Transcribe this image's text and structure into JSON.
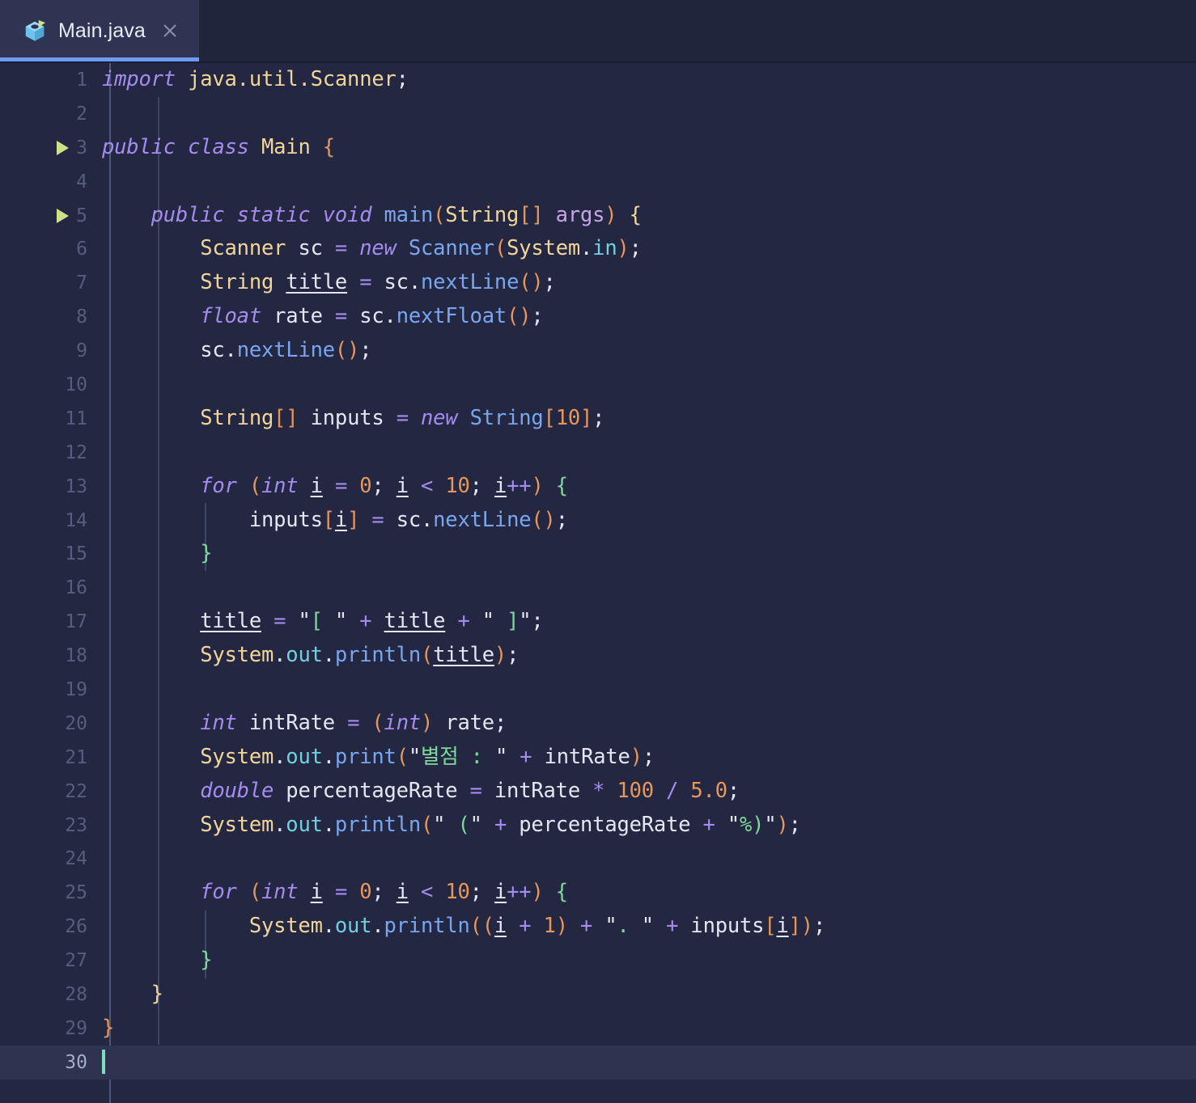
{
  "window": {
    "app": "java-code-editor",
    "background_color": "#232741"
  },
  "tabbar": {
    "background_color": "#21253c",
    "active_indicator_color": "#6c9bf5",
    "tabs": [
      {
        "label": "Main.java",
        "icon": "java-class-icon",
        "close_icon": "close-icon",
        "active": true
      }
    ]
  },
  "editor": {
    "language": "java",
    "total_lines": 30,
    "current_line": 30,
    "caret_column": 1,
    "caret_color": "#7fdcc0",
    "current_line_highlight_color": "#2e3450",
    "gutter": {
      "line_numbers": [
        1,
        2,
        3,
        4,
        5,
        6,
        7,
        8,
        9,
        10,
        11,
        12,
        13,
        14,
        15,
        16,
        17,
        18,
        19,
        20,
        21,
        22,
        23,
        24,
        25,
        26,
        27,
        28,
        29,
        30
      ],
      "run_markers": [
        3,
        5
      ],
      "run_marker_icon": "run-play-icon",
      "run_marker_color": "#cfe08a",
      "number_color": "#555e7e",
      "current_number_color": "#a3acc9"
    },
    "theme_colors": {
      "keyword": "#a48cf0",
      "class_type": "#f2d59b",
      "method": "#7aa6f0",
      "field": "#6fd0e0",
      "identifier": "#e4e7f2",
      "number": "#e8965a",
      "operator": "#a48cf0",
      "string": "#7fd99a",
      "brace_depth_1": "#e8965a",
      "brace_depth_2": "#f2d59b",
      "brace_depth_3": "#7fd99a"
    },
    "source_lines": [
      "import java.util.Scanner;",
      "",
      "public class Main {",
      "",
      "    public static void main(String[] args) {",
      "        Scanner sc = new Scanner(System.in);",
      "        String title = sc.nextLine();",
      "        float rate = sc.nextFloat();",
      "        sc.nextLine();",
      "",
      "        String[] inputs = new String[10];",
      "",
      "        for (int i = 0; i < 10; i++) {",
      "            inputs[i] = sc.nextLine();",
      "        }",
      "",
      "        title = \"[ \" + title + \" ]\";",
      "        System.out.println(title);",
      "",
      "        int intRate = (int) rate;",
      "        System.out.print(\"별점 : \" + intRate);",
      "        double percentageRate = intRate * 100 / 5.0;",
      "        System.out.println(\" (\" + percentageRate + \"%)\");",
      "",
      "        for (int i = 0; i < 10; i++) {",
      "            System.out.println((i + 1) + \". \" + inputs[i]);",
      "        }",
      "    }",
      "}",
      ""
    ]
  }
}
